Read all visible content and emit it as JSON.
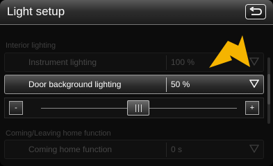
{
  "header": {
    "title": "Light setup"
  },
  "sections": {
    "interior": {
      "label": "Interior lighting"
    },
    "coming_leaving": {
      "label": "Coming/Leaving home function"
    }
  },
  "rows": {
    "instrument": {
      "label": "Instrument lighting",
      "value": "100 %"
    },
    "door": {
      "label": "Door background lighting",
      "value": "50 %"
    },
    "coming_home": {
      "label": "Coming home function",
      "value": "0 s"
    }
  },
  "slider": {
    "minus_label": "-",
    "plus_label": "+",
    "level_percent": 50
  },
  "colors": {
    "arrow_annotation": "#f5b400",
    "active_row_top": "#575757",
    "text_active": "#ffffff",
    "text_disabled": "#474747"
  },
  "icons": {
    "back": "back-arrow-icon",
    "dropdown": "dropdown-triangle-icon"
  }
}
